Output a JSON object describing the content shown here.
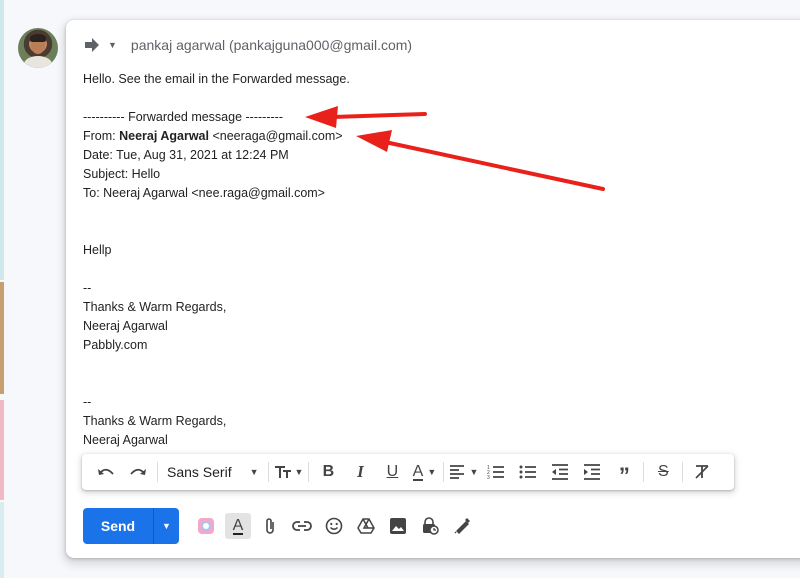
{
  "sender": {
    "display": "pankaj agarwal (pankajguna000@gmail.com)"
  },
  "message": {
    "intro": "Hello. See the email in the Forwarded message.",
    "forward_header": "---------- Forwarded message ---------",
    "from_prefix": "From: ",
    "from_name": "Neeraj Agarwal",
    "from_email": " <neeraga@gmail.com>",
    "date": "Date: Tue, Aug 31, 2021 at 12:24 PM",
    "subject": "Subject: Hello",
    "to": "To: Neeraj Agarwal <nee.raga@gmail.com>",
    "body_text": "Hellp",
    "sig1_dash": "--",
    "sig1_line1": "Thanks & Warm Regards,",
    "sig1_line2": "Neeraj Agarwal",
    "sig1_line3": "Pabbly.com",
    "sig2_dash": "--",
    "sig2_line1": "Thanks & Warm Regards,",
    "sig2_line2": "Neeraj Agarwal"
  },
  "toolbar": {
    "font_family": "Sans Serif",
    "icons": [
      "undo-icon",
      "redo-icon",
      "font-size-icon",
      "bold-icon",
      "italic-icon",
      "underline-icon",
      "text-color-icon",
      "align-icon",
      "numbered-list-icon",
      "bulleted-list-icon",
      "indent-less-icon",
      "indent-more-icon",
      "quote-icon",
      "strikethrough-icon",
      "remove-formatting-icon"
    ]
  },
  "send": {
    "label": "Send"
  },
  "actions": [
    "confidential-color-icon",
    "formatting-options-icon",
    "attach-icon",
    "link-icon",
    "emoji-icon",
    "drive-icon",
    "photo-icon",
    "confidential-mode-icon",
    "signature-icon"
  ],
  "colors": {
    "accent": "#1a73e8",
    "annotation": "#e8221a"
  }
}
